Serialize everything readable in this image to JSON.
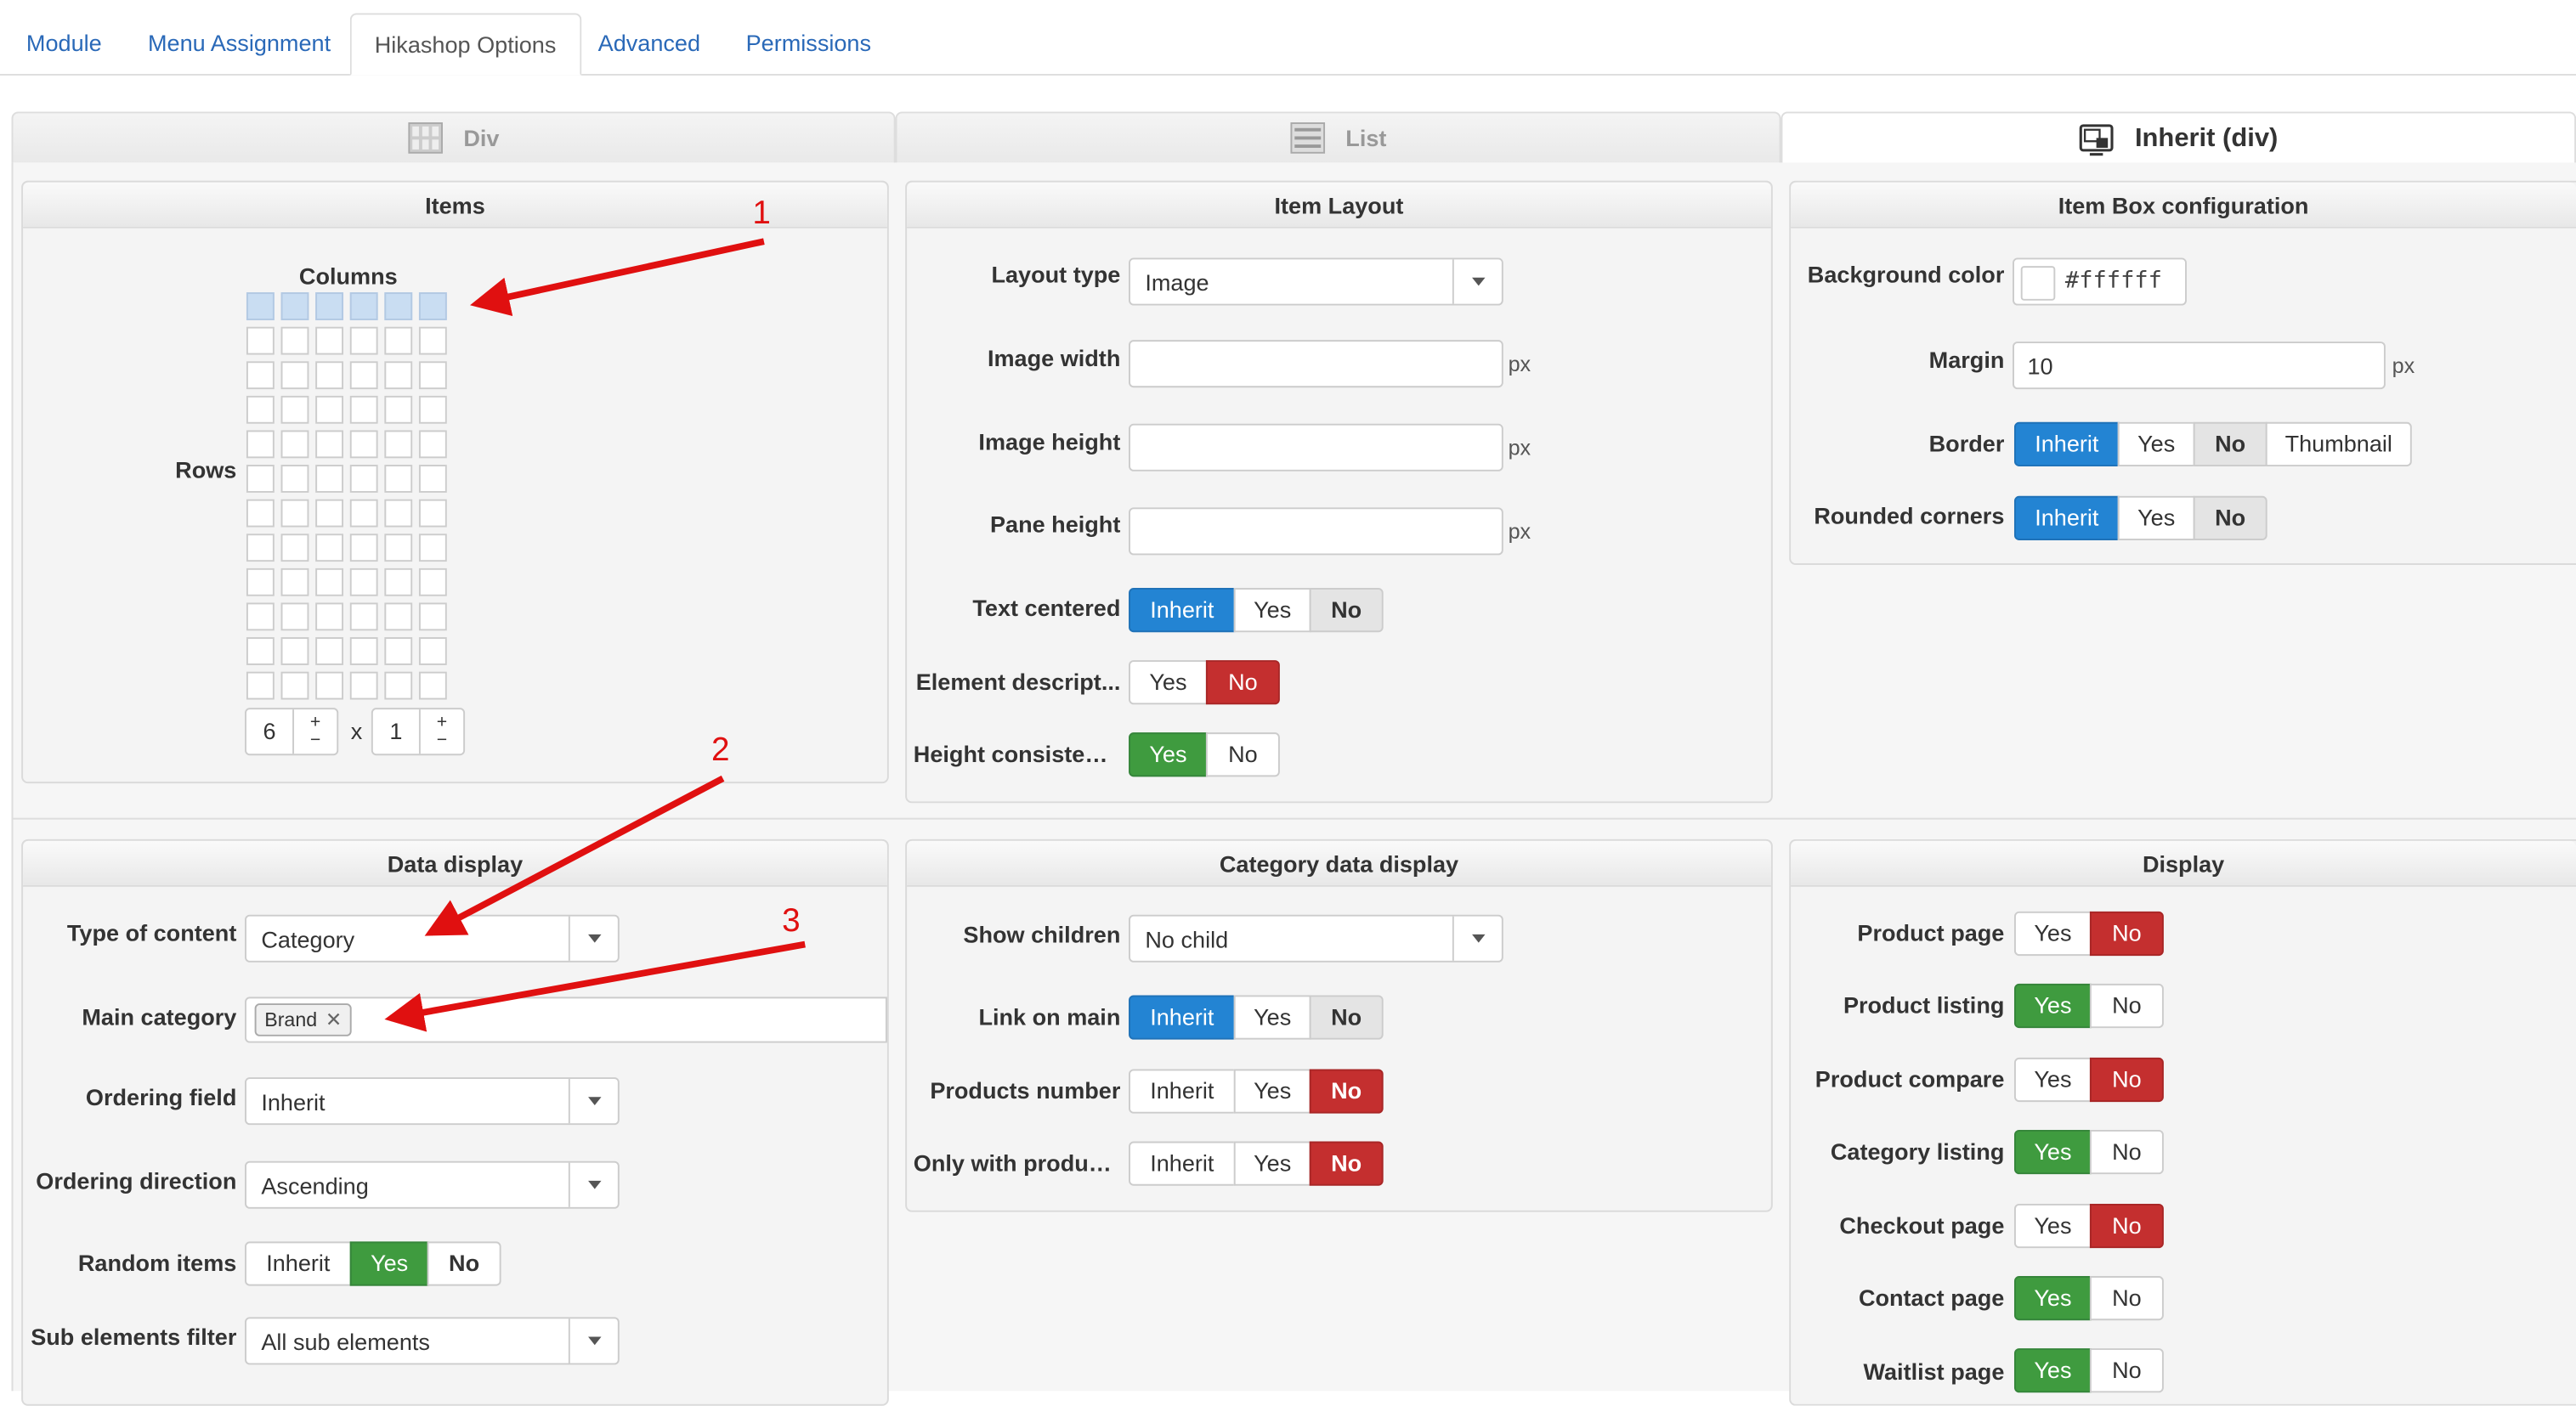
{
  "nav": {
    "tabs": [
      "Module",
      "Menu Assignment",
      "Hikashop Options",
      "Advanced",
      "Permissions"
    ],
    "active_tab": "Hikashop Options"
  },
  "layout_tabs": [
    "Div",
    "List",
    "Inherit (div)"
  ],
  "items_panel": {
    "title": "Items",
    "columns_label": "Columns",
    "rows_label": "Rows",
    "columns_value": "6",
    "rows_value": "1",
    "times": "x",
    "plus": "+",
    "minus": "−"
  },
  "item_layout": {
    "title": "Item Layout",
    "layout_type_label": "Layout type",
    "layout_type_value": "Image",
    "image_width_label": "Image width",
    "image_height_label": "Image height",
    "pane_height_label": "Pane height",
    "unit": "px",
    "text_centered_label": "Text centered",
    "element_desc_label": "Element descript...",
    "height_consistency_label": "Height consistency"
  },
  "item_box": {
    "title": "Item Box configuration",
    "bg_label": "Background color",
    "bg_value": "#ffffff",
    "margin_label": "Margin",
    "margin_value": "10",
    "unit": "px",
    "border_label": "Border",
    "rounded_label": "Rounded corners"
  },
  "data_display": {
    "title": "Data display",
    "type_label": "Type of content",
    "type_value": "Category",
    "main_cat_label": "Main category",
    "main_cat_tag": "Brand",
    "ordering_field_label": "Ordering field",
    "ordering_field_value": "Inherit",
    "ordering_dir_label": "Ordering direction",
    "ordering_dir_value": "Ascending",
    "random_label": "Random items",
    "sub_filter_label": "Sub elements filter",
    "sub_filter_value": "All sub elements"
  },
  "category_display": {
    "title": "Category data display",
    "show_children_label": "Show children",
    "show_children_value": "No child",
    "link_main_label": "Link on main",
    "products_number_label": "Products number",
    "only_with_label": "Only with products"
  },
  "display": {
    "title": "Display",
    "product_page_label": "Product page",
    "product_listing_label": "Product listing",
    "product_compare_label": "Product compare",
    "category_listing_label": "Category listing",
    "checkout_page_label": "Checkout page",
    "contact_page_label": "Contact page",
    "waitlist_page_label": "Waitlist page"
  },
  "buttons": {
    "inherit": "Inherit",
    "yes": "Yes",
    "no": "No",
    "thumbnail": "Thumbnail"
  },
  "annotations": [
    "1",
    "2",
    "3"
  ],
  "colors": {
    "active_blue": "#2384d3",
    "yes_green": "#3f9b3f",
    "no_red": "#c42f2f",
    "arrow_red": "#e01010",
    "link_blue": "#2a69b8"
  }
}
